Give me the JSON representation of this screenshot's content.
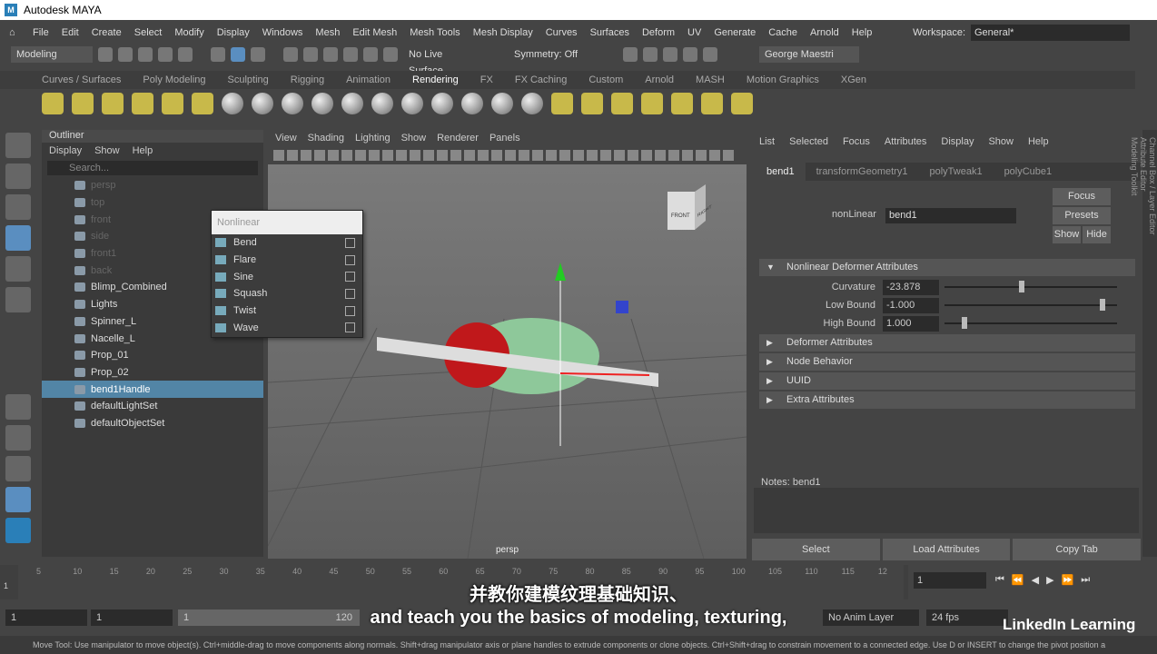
{
  "title": "Autodesk MAYA",
  "menu": [
    "File",
    "Edit",
    "Create",
    "Select",
    "Modify",
    "Display",
    "Windows",
    "Mesh",
    "Edit Mesh",
    "Mesh Tools",
    "Mesh Display",
    "Curves",
    "Surfaces",
    "Deform",
    "UV",
    "Generate",
    "Cache",
    "Arnold",
    "Help"
  ],
  "workspace": {
    "label": "Workspace:",
    "value": "General*"
  },
  "status": {
    "mode": "Modeling",
    "live_surface": "No Live Surface",
    "symmetry": "Symmetry: Off",
    "user": "George Maestri"
  },
  "shelf_tabs": [
    "Curves / Surfaces",
    "Poly Modeling",
    "Sculpting",
    "Rigging",
    "Animation",
    "Rendering",
    "FX",
    "FX Caching",
    "Custom",
    "Arnold",
    "MASH",
    "Motion Graphics",
    "XGen"
  ],
  "shelf_active": "Rendering",
  "outliner": {
    "title": "Outliner",
    "menu": [
      "Display",
      "Show",
      "Help"
    ],
    "search_placeholder": "Search...",
    "items": [
      {
        "label": "persp",
        "dim": true
      },
      {
        "label": "top",
        "dim": true
      },
      {
        "label": "front",
        "dim": true
      },
      {
        "label": "side",
        "dim": true
      },
      {
        "label": "front1",
        "dim": true
      },
      {
        "label": "back",
        "dim": true
      },
      {
        "label": "Blimp_Combined"
      },
      {
        "label": "Lights"
      },
      {
        "label": "Spinner_L"
      },
      {
        "label": "Nacelle_L"
      },
      {
        "label": "Prop_01"
      },
      {
        "label": "Prop_02"
      },
      {
        "label": "bend1Handle",
        "sel": true
      },
      {
        "label": "defaultLightSet"
      },
      {
        "label": "defaultObjectSet"
      }
    ]
  },
  "nonlinear_menu": {
    "title": "Nonlinear",
    "items": [
      "Bend",
      "Flare",
      "Sine",
      "Squash",
      "Twist",
      "Wave"
    ]
  },
  "viewport": {
    "menu": [
      "View",
      "Shading",
      "Lighting",
      "Show",
      "Renderer",
      "Panels"
    ],
    "camera": "persp",
    "cube_front": "FRONT",
    "cube_right": "RIGHT"
  },
  "attr_editor": {
    "menu": [
      "List",
      "Selected",
      "Focus",
      "Attributes",
      "Display",
      "Show",
      "Help"
    ],
    "tabs": [
      "bend1",
      "transformGeometry1",
      "polyTweak1",
      "polyCube1"
    ],
    "node_label": "nonLinear",
    "node_value": "bend1",
    "buttons": {
      "focus": "Focus",
      "presets": "Presets",
      "show": "Show",
      "hide": "Hide"
    },
    "section_open": "Nonlinear Deformer Attributes",
    "attrs": [
      {
        "label": "Curvature",
        "value": "-23.878",
        "slider": 0.43
      },
      {
        "label": "Low Bound",
        "value": "-1.000",
        "slider": 0.9
      },
      {
        "label": "High Bound",
        "value": "1.000",
        "slider": 0.1
      }
    ],
    "sections": [
      "Deformer Attributes",
      "Node Behavior",
      "UUID",
      "Extra Attributes"
    ],
    "notes": "Notes:  bend1",
    "bottom_buttons": [
      "Select",
      "Load Attributes",
      "Copy Tab"
    ]
  },
  "side_tabs": [
    "Channel Box / Layer Editor",
    "Attribute Editor",
    "Modeling Toolkit"
  ],
  "timeline": {
    "ticks": [
      "5",
      "10",
      "15",
      "20",
      "25",
      "30",
      "35",
      "40",
      "45",
      "50",
      "55",
      "60",
      "65",
      "70",
      "75",
      "80",
      "85",
      "90",
      "95",
      "100",
      "105",
      "110",
      "115",
      "12"
    ],
    "start": "1",
    "current": "1"
  },
  "range": {
    "start": "1",
    "inner_start": "1",
    "slider_start": "1",
    "slider_end": "120",
    "anim_layer": "No Anim Layer",
    "fps": "24 fps"
  },
  "help_line": "Move Tool: Use manipulator to move object(s). Ctrl+middle-drag to move components along normals. Shift+drag manipulator axis or plane handles to extrude components or clone objects. Ctrl+Shift+drag to constrain movement to a connected edge. Use D or INSERT to change the pivot position a",
  "subtitle": {
    "zh": "并教你建模纹理基础知识、",
    "en": "and teach you the basics of modeling, texturing,"
  },
  "watermark": "LinkedIn Learning"
}
